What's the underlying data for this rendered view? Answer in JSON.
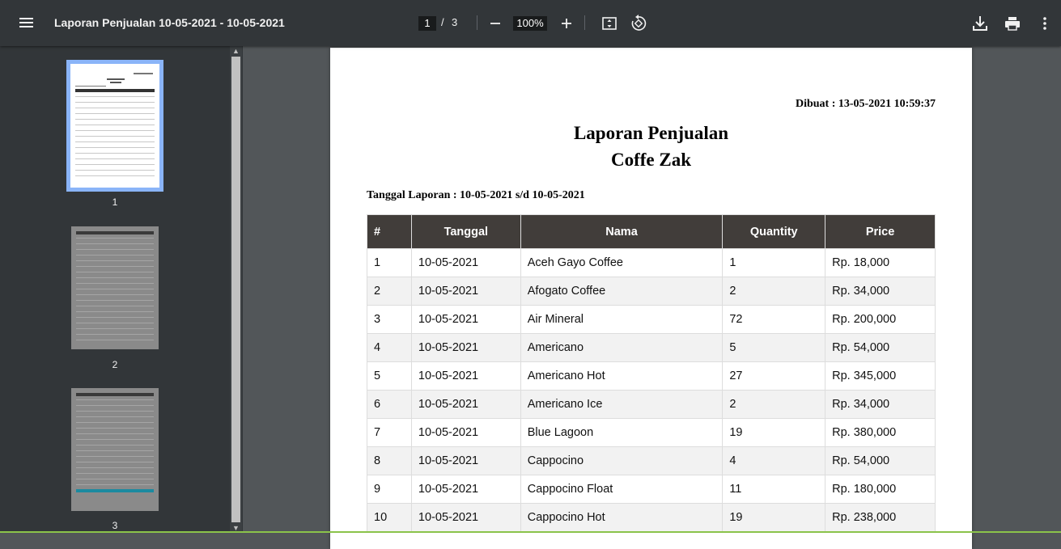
{
  "toolbar": {
    "title": "Laporan Penjualan 10-05-2021 - 10-05-2021",
    "current_page": "1",
    "separator": "/",
    "total_pages": "3",
    "zoom": "100%",
    "icons": [
      "menu-icon",
      "zoom-out-icon",
      "zoom-in-icon",
      "fit-page-icon",
      "rotate-icon",
      "download-icon",
      "print-icon",
      "more-vert-icon"
    ]
  },
  "sidebar": {
    "thumbnails": [
      {
        "label": "1",
        "selected": true
      },
      {
        "label": "2",
        "selected": false
      },
      {
        "label": "3",
        "selected": false
      }
    ]
  },
  "report": {
    "created": "Dibuat : 13-05-2021 10:59:37",
    "title_line1": "Laporan Penjualan",
    "title_line2": "Coffe Zak",
    "date_range": "Tanggal Laporan : 10-05-2021 s/d 10-05-2021",
    "headers": [
      "#",
      "Tanggal",
      "Nama",
      "Quantity",
      "Price"
    ],
    "rows": [
      [
        "1",
        "10-05-2021",
        "Aceh Gayo Coffee",
        "1",
        "Rp. 18,000"
      ],
      [
        "2",
        "10-05-2021",
        "Afogato Coffee",
        "2",
        "Rp. 34,000"
      ],
      [
        "3",
        "10-05-2021",
        "Air Mineral",
        "72",
        "Rp. 200,000"
      ],
      [
        "4",
        "10-05-2021",
        "Americano",
        "5",
        "Rp. 54,000"
      ],
      [
        "5",
        "10-05-2021",
        "Americano Hot",
        "27",
        "Rp. 345,000"
      ],
      [
        "6",
        "10-05-2021",
        "Americano Ice",
        "2",
        "Rp. 34,000"
      ],
      [
        "7",
        "10-05-2021",
        "Blue Lagoon",
        "19",
        "Rp. 380,000"
      ],
      [
        "8",
        "10-05-2021",
        "Cappocino",
        "4",
        "Rp. 54,000"
      ],
      [
        "9",
        "10-05-2021",
        "Cappocino Float",
        "11",
        "Rp. 180,000"
      ],
      [
        "10",
        "10-05-2021",
        "Cappocino Hot",
        "19",
        "Rp. 238,000"
      ]
    ]
  }
}
